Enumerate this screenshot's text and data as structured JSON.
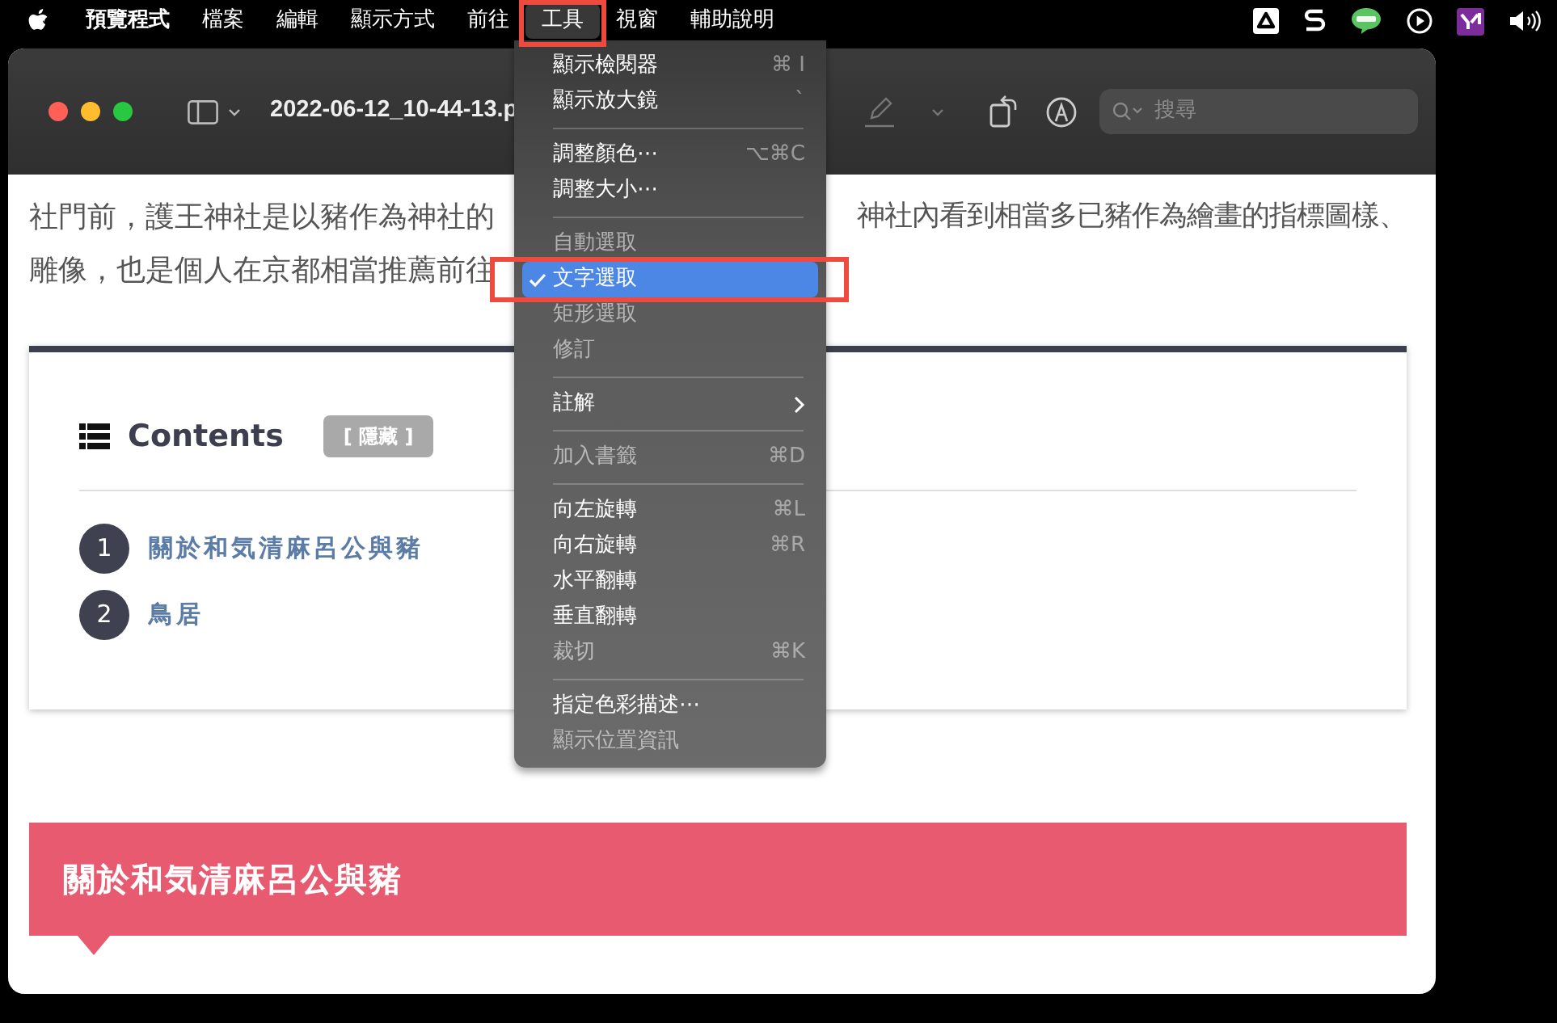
{
  "menu_bar": {
    "items": [
      {
        "label": "預覽程式",
        "kind": "app",
        "selected": false,
        "highlighted": false
      },
      {
        "label": "檔案",
        "kind": "menu",
        "selected": false,
        "highlighted": false
      },
      {
        "label": "編輯",
        "kind": "menu",
        "selected": false,
        "highlighted": false
      },
      {
        "label": "顯示方式",
        "kind": "menu",
        "selected": false,
        "highlighted": false
      },
      {
        "label": "前往",
        "kind": "menu",
        "selected": false,
        "highlighted": false
      },
      {
        "label": "工具",
        "kind": "menu",
        "selected": true,
        "highlighted": true
      },
      {
        "label": "視窗",
        "kind": "menu",
        "selected": false,
        "highlighted": false
      },
      {
        "label": "輔助說明",
        "kind": "menu",
        "selected": false,
        "highlighted": false
      }
    ]
  },
  "window": {
    "title": "2022-06-12_10-44-13.p",
    "search_placeholder": "搜尋"
  },
  "document": {
    "paragraph_lines": [
      {
        "left": "社門前，護王神社是以豬作為神社的",
        "right": "神社內看到相當多已豬作為繪畫的指標圖樣、"
      },
      {
        "left": "雕像，也是個人在京都相當推薦前往"
      }
    ],
    "toc": {
      "title": "Contents",
      "toggle": "[ 隱藏 ]",
      "items": [
        {
          "number": "1",
          "label": "關於和気清麻呂公與豬"
        },
        {
          "number": "2",
          "label": "鳥居"
        }
      ]
    },
    "section_heading": "關於和気清麻呂公與豬"
  },
  "menu": {
    "items": [
      {
        "kind": "item",
        "label": "顯示檢閱器",
        "shortcut": "⌘ I",
        "disabled": false,
        "checked": false,
        "selected": false,
        "highlighted": false,
        "submenu": false
      },
      {
        "kind": "item",
        "label": "顯示放大鏡",
        "shortcut": "`",
        "disabled": false,
        "checked": false,
        "selected": false,
        "highlighted": false,
        "submenu": false
      },
      {
        "kind": "separator"
      },
      {
        "kind": "item",
        "label": "調整顏色⋯",
        "shortcut": "⌥⌘C",
        "disabled": false,
        "checked": false,
        "selected": false,
        "highlighted": false,
        "submenu": false
      },
      {
        "kind": "item",
        "label": "調整大小⋯",
        "disabled": false,
        "checked": false,
        "selected": false,
        "highlighted": false,
        "submenu": false
      },
      {
        "kind": "separator"
      },
      {
        "kind": "item",
        "label": "自動選取",
        "disabled": true,
        "checked": false,
        "selected": false,
        "highlighted": false,
        "submenu": false
      },
      {
        "kind": "item",
        "label": "文字選取",
        "disabled": false,
        "checked": true,
        "selected": true,
        "highlighted": true,
        "submenu": false
      },
      {
        "kind": "item",
        "label": "矩形選取",
        "disabled": true,
        "checked": false,
        "selected": false,
        "highlighted": false,
        "submenu": false
      },
      {
        "kind": "item",
        "label": "修訂",
        "disabled": true,
        "checked": false,
        "selected": false,
        "highlighted": false,
        "submenu": false
      },
      {
        "kind": "separator"
      },
      {
        "kind": "item",
        "label": "註解",
        "disabled": false,
        "checked": false,
        "selected": false,
        "highlighted": false,
        "submenu": true
      },
      {
        "kind": "separator"
      },
      {
        "kind": "item",
        "label": "加入書籤",
        "shortcut": "⌘D",
        "disabled": true,
        "checked": false,
        "selected": false,
        "highlighted": false,
        "submenu": false
      },
      {
        "kind": "separator"
      },
      {
        "kind": "item",
        "label": "向左旋轉",
        "shortcut": "⌘L",
        "disabled": false,
        "checked": false,
        "selected": false,
        "highlighted": false,
        "submenu": false
      },
      {
        "kind": "item",
        "label": "向右旋轉",
        "shortcut": "⌘R",
        "disabled": false,
        "checked": false,
        "selected": false,
        "highlighted": false,
        "submenu": false
      },
      {
        "kind": "item",
        "label": "水平翻轉",
        "disabled": false,
        "checked": false,
        "selected": false,
        "highlighted": false,
        "submenu": false
      },
      {
        "kind": "item",
        "label": "垂直翻轉",
        "disabled": false,
        "checked": false,
        "selected": false,
        "highlighted": false,
        "submenu": false
      },
      {
        "kind": "item",
        "label": "裁切",
        "shortcut": "⌘K",
        "disabled": true,
        "checked": false,
        "selected": false,
        "highlighted": false,
        "submenu": false
      },
      {
        "kind": "separator"
      },
      {
        "kind": "item",
        "label": "指定色彩描述⋯",
        "disabled": false,
        "checked": false,
        "selected": false,
        "highlighted": false,
        "submenu": false
      },
      {
        "kind": "item",
        "label": "顯示位置資訊",
        "disabled": true,
        "checked": false,
        "selected": false,
        "highlighted": false,
        "submenu": false
      }
    ]
  }
}
